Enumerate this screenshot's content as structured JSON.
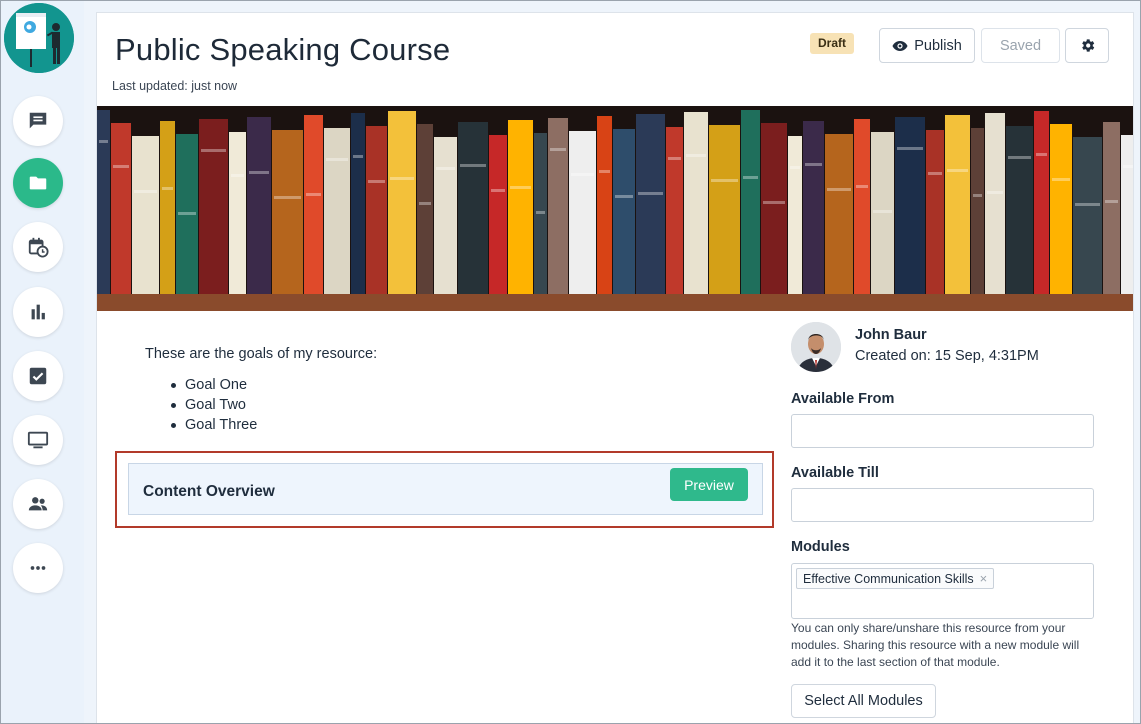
{
  "sidebar": {
    "items": [
      {
        "name": "messages",
        "icon": "chat-bubble-icon",
        "active": false
      },
      {
        "name": "resources",
        "icon": "folder-icon",
        "active": true
      },
      {
        "name": "schedule",
        "icon": "calendar-clock-icon",
        "active": false
      },
      {
        "name": "analytics",
        "icon": "bar-chart-icon",
        "active": false
      },
      {
        "name": "tasks",
        "icon": "checkbox-icon",
        "active": false
      },
      {
        "name": "screen",
        "icon": "monitor-icon",
        "active": false
      },
      {
        "name": "people",
        "icon": "people-icon",
        "active": false
      },
      {
        "name": "more",
        "icon": "more-dots-icon",
        "active": false
      }
    ]
  },
  "header": {
    "title": "Public Speaking Course",
    "updated": "Last updated: just now",
    "badge": "Draft",
    "publish_label": "Publish",
    "saved_label": "Saved"
  },
  "content": {
    "intro": "These are the goals of my resource:",
    "goals": [
      "Goal One",
      "Goal Two",
      "Goal Three"
    ],
    "overview_title": "Content Overview",
    "preview_label": "Preview"
  },
  "details": {
    "author": "John Baur",
    "created": "Created on: 15 Sep, 4:31PM",
    "available_from_label": "Available From",
    "available_from_value": "",
    "available_till_label": "Available Till",
    "available_till_value": "",
    "modules_label": "Modules",
    "modules": [
      "Effective Communication Skills"
    ],
    "modules_help": "You can only share/unshare this resource from your modules. Sharing this resource with a new module will add it to the last section of that module.",
    "select_all_label": "Select All Modules"
  },
  "colors": {
    "accent": "#2fb98c",
    "highlight_border": "#b23a2a",
    "draft_badge": "#f7e2b5"
  }
}
